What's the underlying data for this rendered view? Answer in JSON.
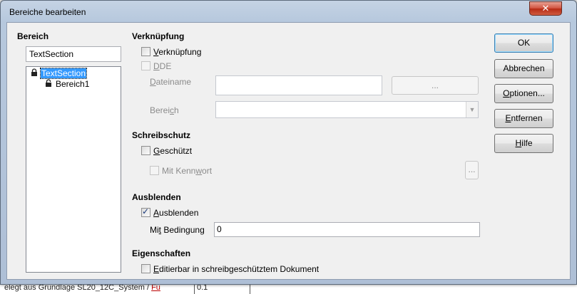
{
  "dialog": {
    "title": "Bereiche bearbeiten",
    "close_symbol": "✕"
  },
  "left": {
    "heading": "Bereich",
    "name_value": "TextSection",
    "tree": [
      {
        "label": "TextSection",
        "icon": "lock-icon",
        "selected": true
      },
      {
        "label": "Bereich1",
        "icon": "lock-open-icon",
        "selected": false
      }
    ]
  },
  "link": {
    "heading": "Verknüpfung",
    "link_checkbox": {
      "pre": "",
      "key": "V",
      "post": "erknüpfung",
      "checked": false
    },
    "dde_checkbox": {
      "pre": "",
      "key": "D",
      "post": "DE",
      "checked": false
    },
    "filename_label": {
      "pre": "",
      "key": "D",
      "post": "ateiname"
    },
    "filename_value": "",
    "browse_label": "...",
    "section_label": {
      "pre": "Berei",
      "key": "c",
      "post": "h"
    },
    "section_value": ""
  },
  "protect": {
    "heading": "Schreibschutz",
    "protected_checkbox": {
      "pre": "",
      "key": "G",
      "post": "eschützt",
      "checked": false
    },
    "password_checkbox": {
      "pre": "Mit Kenn",
      "key": "w",
      "post": "ort",
      "checked": false
    },
    "password_button": "..."
  },
  "hide": {
    "heading": "Ausblenden",
    "hide_checkbox": {
      "pre": "",
      "key": "A",
      "post": "usblenden",
      "checked": true
    },
    "condition_label": {
      "pre": "Mi",
      "key": "t",
      "post": " Bedingung"
    },
    "condition_value": "0"
  },
  "properties": {
    "heading": "Eigenschaften",
    "editable_checkbox": {
      "pre": "",
      "key": "E",
      "post": "ditierbar in schreibgeschütztem Dokument",
      "checked": false
    }
  },
  "buttons": {
    "ok": {
      "pre": "OK",
      "key": "",
      "post": ""
    },
    "cancel": {
      "pre": "Abbrechen",
      "key": "",
      "post": ""
    },
    "options": {
      "pre": "",
      "key": "O",
      "post": "ptionen..."
    },
    "remove": {
      "pre": "",
      "key": "E",
      "post": "ntfernen"
    },
    "help": {
      "pre": "",
      "key": "H",
      "post": "ilfe"
    }
  },
  "background": {
    "status_text_pre": "elegt aus Grundlage SL20_12C_System / ",
    "status_text_link": "Fu",
    "status_value": "0.1"
  }
}
